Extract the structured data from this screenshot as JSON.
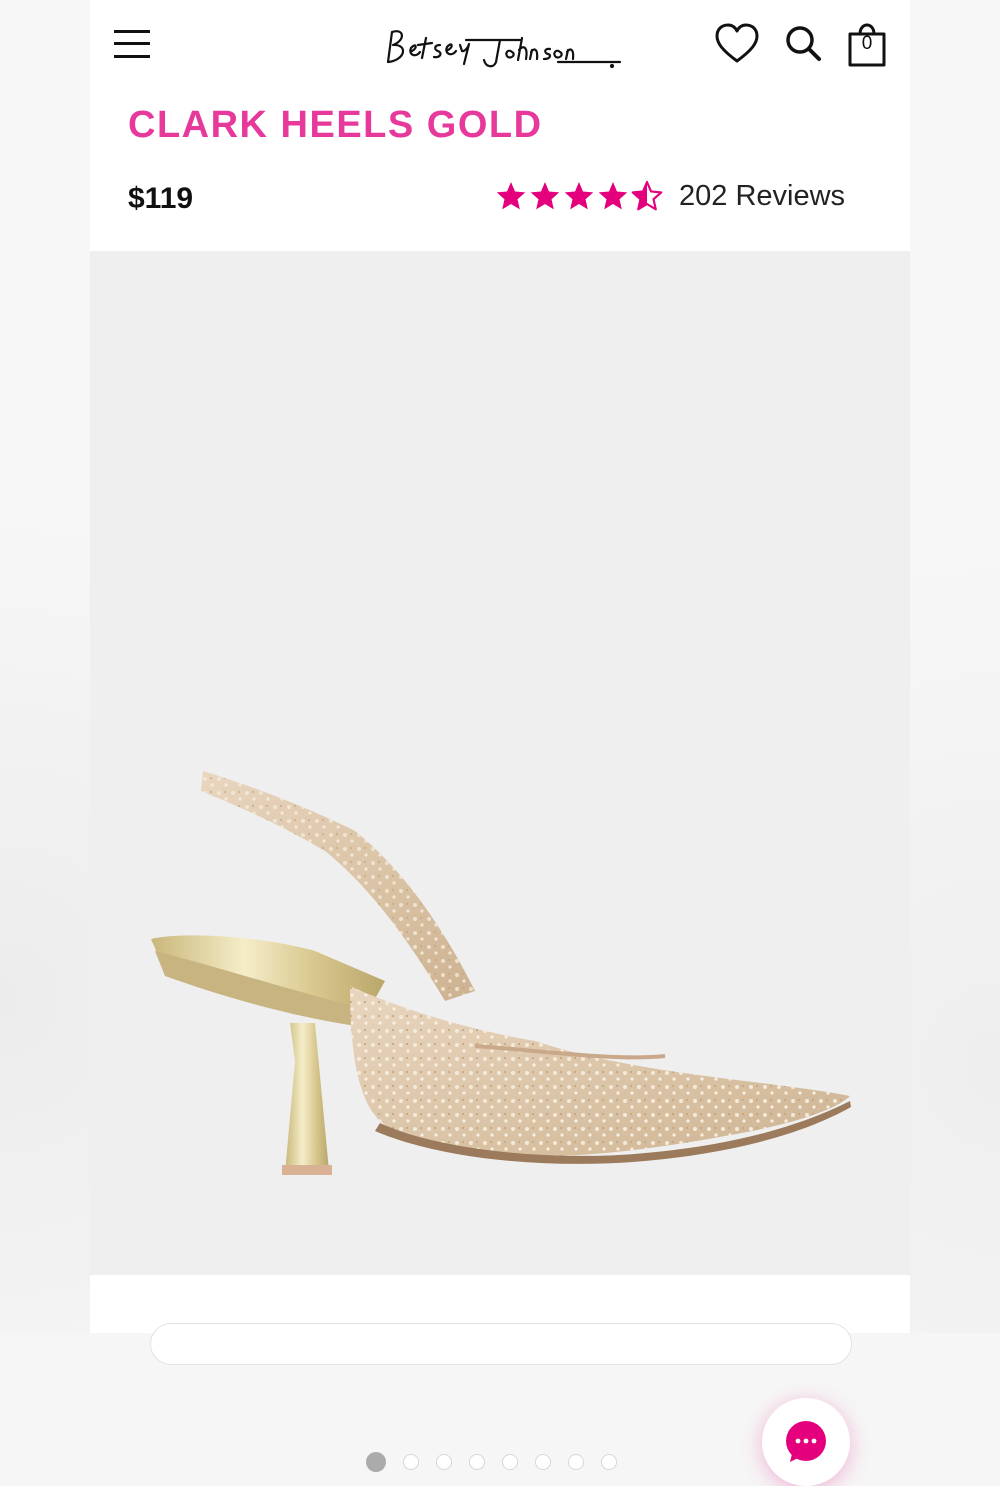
{
  "header": {
    "logo_text": "Betsey Johnson",
    "bag_count": "0"
  },
  "product": {
    "title": "CLARK HEELS GOLD",
    "price": "$119",
    "rating": 4.5,
    "reviews_label": "202 Reviews"
  },
  "gallery": {
    "image_count": 8,
    "active_index": 0
  },
  "colors": {
    "brand_pink": "#e6399b",
    "star_pink": "#e4007c",
    "gallery_bg": "#efefef"
  },
  "icons": [
    "menu-icon",
    "heart-icon",
    "search-icon",
    "bag-icon",
    "chat-icon",
    "star-icon"
  ]
}
